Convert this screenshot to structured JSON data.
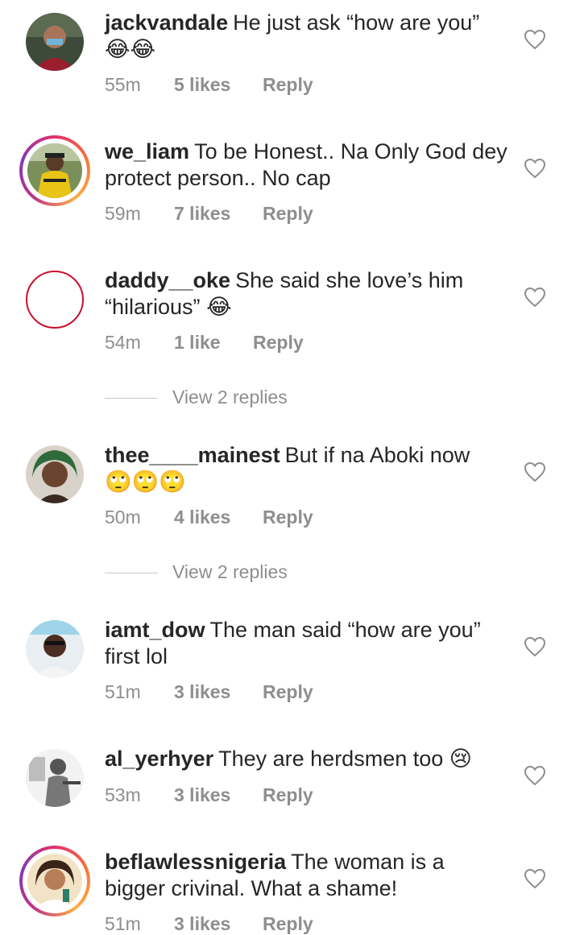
{
  "comments": [
    {
      "username": "jackvandale",
      "text": "He just  ask “how are you”",
      "emoji": "😂😂",
      "time": "55m",
      "likes": "5 likes",
      "reply": "Reply",
      "icon": "heart-outline-icon"
    },
    {
      "username": "we_liam",
      "text": "To be Honest.. Na Only God dey protect person.. No cap",
      "emoji": "",
      "time": "59m",
      "likes": "7 likes",
      "reply": "Reply",
      "icon": "heart-outline-icon"
    },
    {
      "username": "daddy__oke",
      "text": "She said she love’s him “hilarious”",
      "emoji": "😂",
      "time": "54m",
      "likes": "1 like",
      "reply": "Reply",
      "icon": "heart-outline-icon",
      "view_replies": "View 2 replies"
    },
    {
      "username": "thee____mainest",
      "text": "But if na Aboki now",
      "emoji": "🙄🙄🙄",
      "time": "50m",
      "likes": "4 likes",
      "reply": "Reply",
      "icon": "heart-outline-icon",
      "view_replies": "View 2 replies"
    },
    {
      "username": "iamt_dow",
      "text": "The man said “how are you” first lol",
      "emoji": "",
      "time": "51m",
      "likes": "3 likes",
      "reply": "Reply",
      "icon": "heart-outline-icon"
    },
    {
      "username": "al_yerhyer",
      "text": "They are herdsmen too",
      "emoji": "😢",
      "time": "53m",
      "likes": "3 likes",
      "reply": "Reply",
      "icon": "heart-outline-icon"
    },
    {
      "username": "beflawlessnigeria",
      "text": "The woman is a bigger crivinal. What a shame!",
      "emoji": "",
      "time": "51m",
      "likes": "3 likes",
      "reply": "Reply",
      "icon": "heart-outline-icon"
    }
  ],
  "colors": {
    "text": "#262626",
    "meta": "#8e8e8e",
    "story_ring": "#e1306c"
  }
}
